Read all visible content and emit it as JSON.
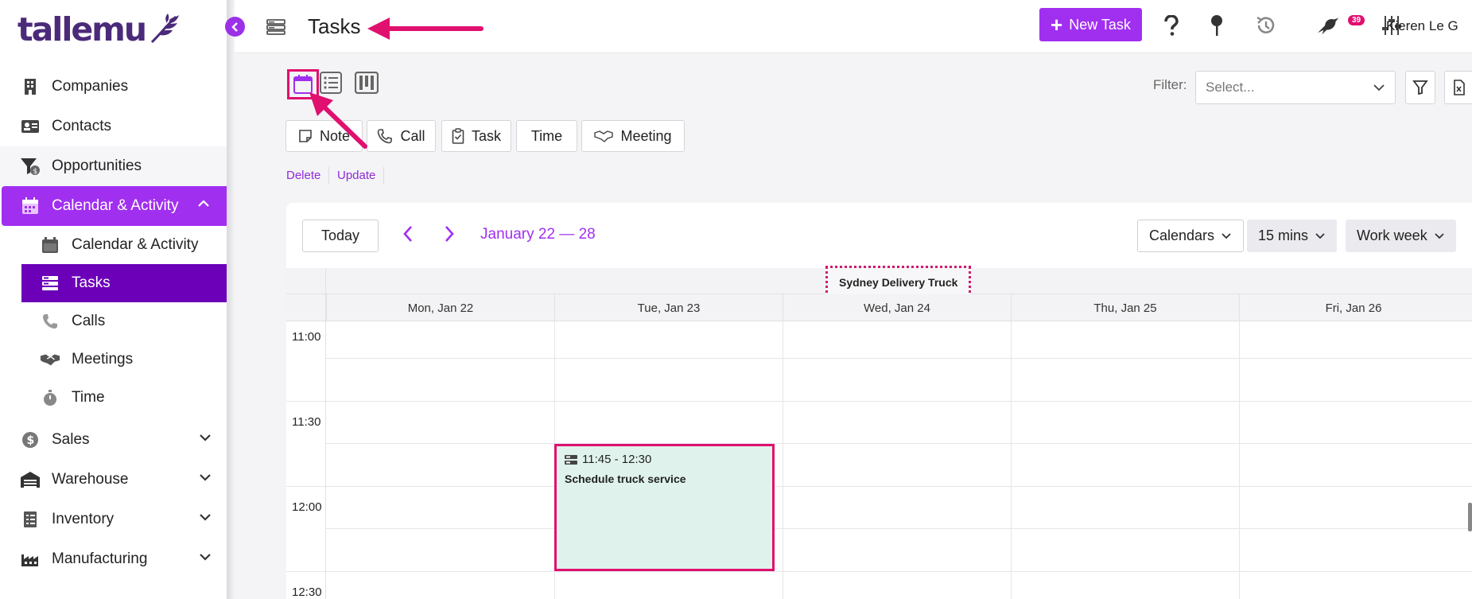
{
  "app": {
    "logo_text": "tallemu"
  },
  "sidebar": {
    "items": [
      {
        "label": "Companies",
        "icon": "building-icon"
      },
      {
        "label": "Contacts",
        "icon": "contact-card-icon"
      },
      {
        "label": "Opportunities",
        "icon": "funnel-icon"
      },
      {
        "label": "Calendar & Activity",
        "icon": "calendar-icon",
        "active": true
      },
      {
        "label": "Sales",
        "icon": "dollar-icon"
      },
      {
        "label": "Warehouse",
        "icon": "warehouse-icon"
      },
      {
        "label": "Inventory",
        "icon": "inventory-icon"
      },
      {
        "label": "Manufacturing",
        "icon": "factory-icon"
      }
    ],
    "subitems": [
      {
        "label": "Calendar & Activity",
        "icon": "calendar-icon"
      },
      {
        "label": "Tasks",
        "icon": "tasks-icon",
        "active": true
      },
      {
        "label": "Calls",
        "icon": "phone-icon"
      },
      {
        "label": "Meetings",
        "icon": "handshake-icon"
      },
      {
        "label": "Time",
        "icon": "stopwatch-icon"
      }
    ]
  },
  "header": {
    "title": "Tasks",
    "new_task_label": "New Task",
    "notification_count": "39",
    "user_name": "Kieren Le G"
  },
  "toolbar": {
    "filter_label": "Filter:",
    "filter_placeholder": "Select...",
    "actions": [
      "Note",
      "Call",
      "Task",
      "Time",
      "Meeting"
    ],
    "delete_label": "Delete",
    "update_label": "Update"
  },
  "calendar": {
    "today_label": "Today",
    "range_title": "January 22 — 28",
    "calendars_label": "Calendars",
    "interval_label": "15 mins",
    "view_label": "Work week",
    "resource": "Sydney Delivery Truck",
    "days": [
      "Mon, Jan 22",
      "Tue, Jan 23",
      "Wed, Jan 24",
      "Thu, Jan 25",
      "Fri, Jan 26"
    ],
    "times": [
      "11:00",
      "11:30",
      "12:00",
      "12:30"
    ],
    "event": {
      "time": "11:45 - 12:30",
      "title": "Schedule truck service",
      "day": "Tue, Jan 23"
    }
  },
  "colors": {
    "accent": "#a12ff0",
    "accent_dark": "#6b00b8",
    "annotation": "#e0106f",
    "event_bg": "#dff3ec"
  }
}
